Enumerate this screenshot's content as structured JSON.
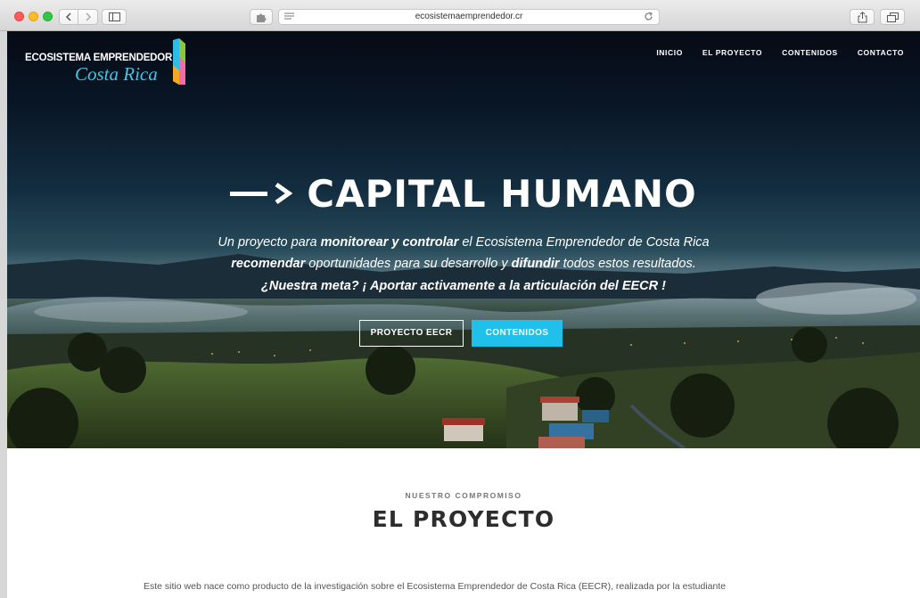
{
  "browser": {
    "url": "ecosistemaemprendedor.cr"
  },
  "brand": {
    "line1": "ECOSISTEMA EMPRENDEDOR",
    "line2": "Costa Rica",
    "accent_color": "#1fc0ea"
  },
  "nav": {
    "items": [
      {
        "label": "INICIO"
      },
      {
        "label": "EL PROYECTO"
      },
      {
        "label": "CONTENIDOS"
      },
      {
        "label": "CONTACTO"
      }
    ]
  },
  "hero": {
    "title": "CAPITAL HUMANO",
    "line1": {
      "a": "Un proyecto para ",
      "b": "monitorear y controlar",
      "c": " el Ecosistema Emprendedor de Costa Rica"
    },
    "line2": {
      "a": "recomendar",
      "b": " oportunidades para su desarrollo y ",
      "c": "difundir",
      "d": " todos estos resultados."
    },
    "line3": "¿Nuestra meta? ¡ Aportar activamente a la articulación del EECR !",
    "buttons": {
      "primary": "PROYECTO EECR",
      "secondary": "CONTENIDOS"
    }
  },
  "section": {
    "kicker": "NUESTRO COMPROMISO",
    "title": "EL PROYECTO",
    "paragraph_line1": "Este sitio web nace como producto de la investigación sobre el Ecosistema Emprendedor de Costa Rica (EECR), realizada por la estudiante"
  },
  "icons": {
    "back": "chevron-left-icon",
    "forward": "chevron-right-icon",
    "sidebar": "sidebar-icon",
    "extension": "puzzle-icon",
    "reader": "reader-icon",
    "reload": "reload-icon",
    "share": "share-icon",
    "tabs": "tabs-icon"
  }
}
